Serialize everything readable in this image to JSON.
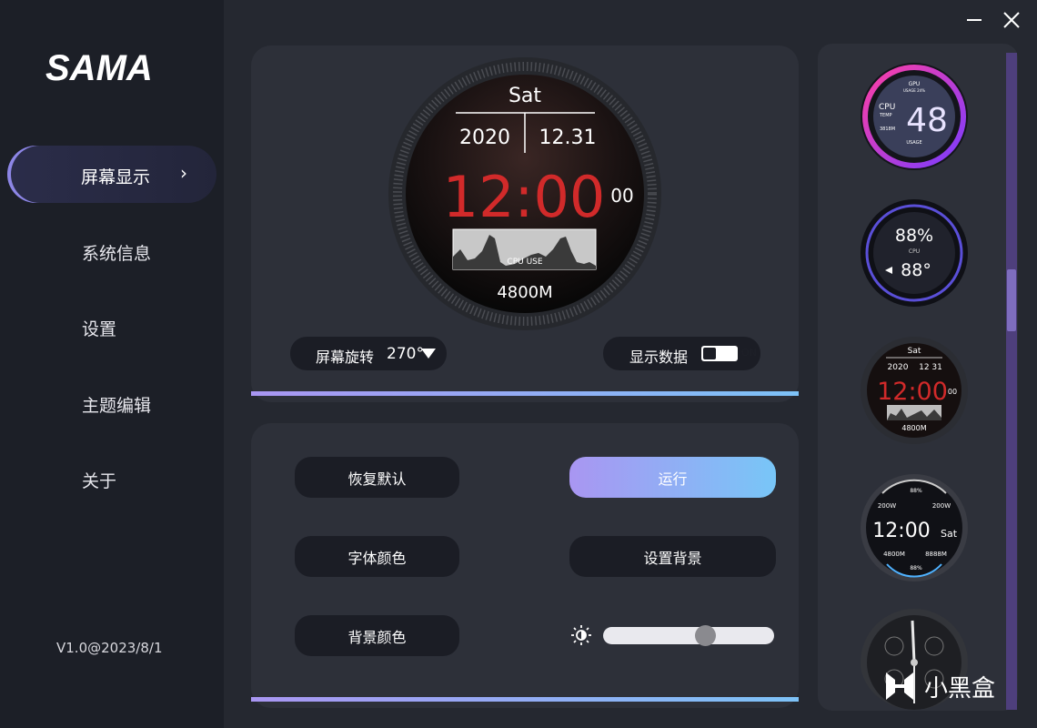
{
  "app": {
    "logo": "SAMA",
    "version": "V1.0@2023/8/1"
  },
  "window": {
    "minimize_icon": "minimize-icon",
    "close_icon": "close-icon"
  },
  "sidebar": {
    "items": [
      {
        "label": "屏幕显示",
        "active": true
      },
      {
        "label": "系统信息"
      },
      {
        "label": "设置"
      },
      {
        "label": "主题编辑"
      },
      {
        "label": "关于"
      }
    ]
  },
  "preview": {
    "day": "Sat",
    "year": "2020",
    "date": "12.31",
    "time": "12:00",
    "seconds": "00",
    "graph_label": "CPU USE",
    "freq": "4800M"
  },
  "controls": {
    "rotation_label": "屏幕旋转",
    "rotation_value": "270°",
    "show_data_label": "显示数据",
    "show_data_state": "ON",
    "restore_default": "恢复默认",
    "run": "运行",
    "font_color": "字体颜色",
    "set_background": "设置背景",
    "background_color": "背景颜色",
    "brightness_icon": "brightness-icon",
    "brightness_fraction": 0.6
  },
  "themes": {
    "t1": {
      "top": "GPU",
      "usage": "USAGE 24%",
      "cpu": "CPU",
      "temp": "TEMP",
      "freq": "3818M",
      "value": "48",
      "bottom": "USAGE"
    },
    "t2": {
      "usage": "88%",
      "label": "CPU",
      "temp": "88°"
    },
    "t3": {
      "day": "Sat",
      "year": "2020",
      "date": "12 31",
      "time": "12:00",
      "seconds": "00",
      "freq": "4800M"
    },
    "t4": {
      "pct_top": "88%",
      "power_l": "200W",
      "power_r": "200W",
      "time": "12:00",
      "day": "Sat",
      "freq_l": "4800M",
      "freq_r": "8888M",
      "pct_bottom": "88%"
    }
  },
  "watermark": {
    "text": "小黑盒"
  },
  "colors": {
    "accent_start": "#a996f2",
    "accent_end": "#78c6f7",
    "time_red": "#d12a2a"
  }
}
